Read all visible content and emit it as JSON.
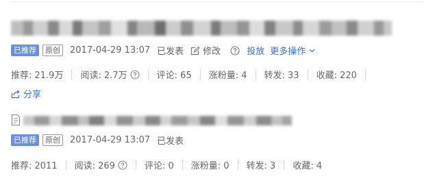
{
  "articles": [
    {
      "badge_recommended": "已推荐",
      "badge_original": "原创",
      "date": "2017-04-29 13:07",
      "status": "已发表",
      "edit_label": "修改",
      "promote_label": "投放",
      "more_label": "更多操作",
      "stats": {
        "recommend": "推荐: 21.9万",
        "read": "阅读: 2.7万",
        "comment": "评论: 65",
        "followers": "涨粉量: 4",
        "forward": "转发: 33",
        "collect": "收藏: 220"
      },
      "share_label": "分享"
    },
    {
      "badge_recommended": "已推荐",
      "badge_original": "原创",
      "date": "2017-04-29 13:07",
      "status": "已发表",
      "stats": {
        "recommend": "推荐: 2011",
        "read": "阅读: 269",
        "comment": "评论: 0",
        "followers": "涨粉量: 0",
        "forward": "转发: 3",
        "collect": "收藏: 4"
      }
    }
  ],
  "icons": {
    "edit": "edit-icon",
    "help": "help-circle-icon",
    "more": "chevron-down-icon",
    "share": "share-icon",
    "document": "document-icon"
  },
  "colors": {
    "link": "#3d6fc6",
    "badge_bg": "#6c8edb",
    "text": "#666666"
  }
}
